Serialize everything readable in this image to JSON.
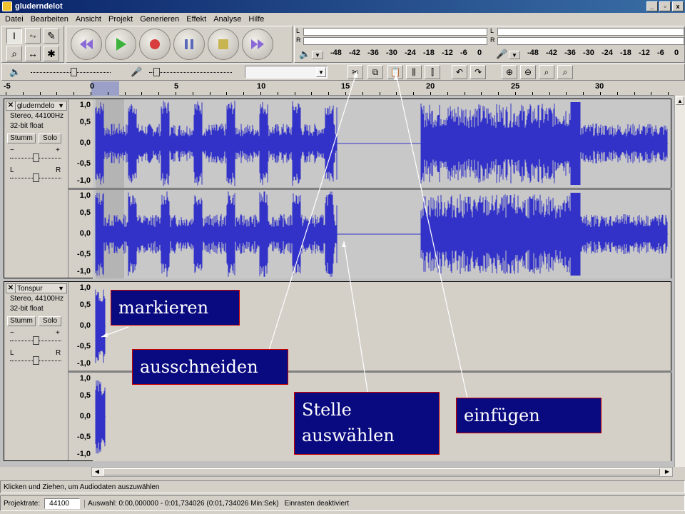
{
  "window": {
    "title": "gluderndelot",
    "min": "_",
    "max": "▫",
    "close": "x"
  },
  "menu": [
    "Datei",
    "Bearbeiten",
    "Ansicht",
    "Projekt",
    "Generieren",
    "Effekt",
    "Analyse",
    "Hilfe"
  ],
  "tools": {
    "select": "I",
    "envelope": "⥊",
    "draw": "✎",
    "zoom": "⌕",
    "timeshift": "↔",
    "multi": "✱"
  },
  "transport": [
    "skip-start",
    "play",
    "record",
    "pause",
    "stop",
    "skip-end"
  ],
  "meters": {
    "left_l": "L",
    "left_r": "R",
    "right_l": "L",
    "right_r": "R",
    "scale": [
      "-48",
      "-42",
      "-36",
      "-30",
      "-24",
      "-18",
      "-12",
      "-6",
      "0"
    ]
  },
  "ruler": [
    "-5",
    "0",
    "5",
    "10",
    "15",
    "20",
    "25",
    "30"
  ],
  "tracks": [
    {
      "name": "gluderndelo",
      "format": "Stereo, 44100Hz",
      "bits": "32-bit float",
      "mute": "Stumm",
      "solo": "Solo",
      "gain_minus": "−",
      "gain_plus": "+",
      "pan_l": "L",
      "pan_r": "R",
      "scale": [
        "1,0",
        "0,5",
        "0,0",
        "-0,5",
        "-1,0"
      ]
    },
    {
      "name": "Tonspur",
      "format": "Stereo, 44100Hz",
      "bits": "32-bit float",
      "mute": "Stumm",
      "solo": "Solo",
      "gain_minus": "−",
      "gain_plus": "+",
      "pan_l": "L",
      "pan_r": "R",
      "scale": [
        "1,0",
        "0,5",
        "0,0",
        "-0,5",
        "-1,0"
      ]
    }
  ],
  "callouts": {
    "markieren": "markieren",
    "ausschneiden": "ausschneiden",
    "stelle_line1": "Stelle",
    "stelle_line2": "auswählen",
    "einfuegen": "einfügen"
  },
  "status": {
    "hint": "Klicken und Ziehen, um Audiodaten auszuwählen",
    "rate_label": "Projektrate:",
    "rate_value": "44100",
    "selection": "Auswahl: 0:00,000000 - 0:01,734026 (0:01,734026 Min:Sek)",
    "snap": "Einrasten deaktiviert"
  },
  "colors": {
    "wave": "#3232c8",
    "title": "#0a246a",
    "callout_bg": "#0a0a80",
    "callout_border": "#cc0000"
  }
}
